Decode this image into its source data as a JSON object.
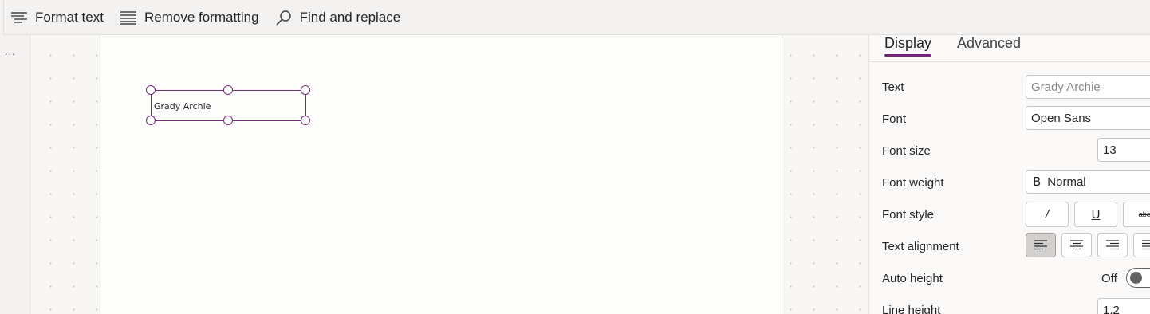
{
  "toolbar": {
    "format_text": "Format text",
    "remove_formatting": "Remove formatting",
    "find_replace": "Find and replace"
  },
  "gutter": {
    "more": "..."
  },
  "canvas": {
    "label_text": "Grady Archie"
  },
  "panel": {
    "tabs": {
      "display": "Display",
      "advanced": "Advanced"
    },
    "text": {
      "label": "Text",
      "value": "Grady Archie"
    },
    "font": {
      "label": "Font",
      "value": "Open Sans"
    },
    "font_size": {
      "label": "Font size",
      "value": "13"
    },
    "font_weight": {
      "label": "Font weight",
      "glyph": "B",
      "value": "Normal"
    },
    "font_style": {
      "label": "Font style",
      "italic": "/",
      "underline": "U",
      "strike": "abc"
    },
    "text_alignment": {
      "label": "Text alignment",
      "selected": "left"
    },
    "auto_height": {
      "label": "Auto height",
      "state_text": "Off"
    },
    "line_height": {
      "label": "Line height",
      "value": "1.2"
    }
  },
  "colors": {
    "accent": "#742774",
    "background": "#f3f2f1",
    "panel": "#faf9f8"
  }
}
